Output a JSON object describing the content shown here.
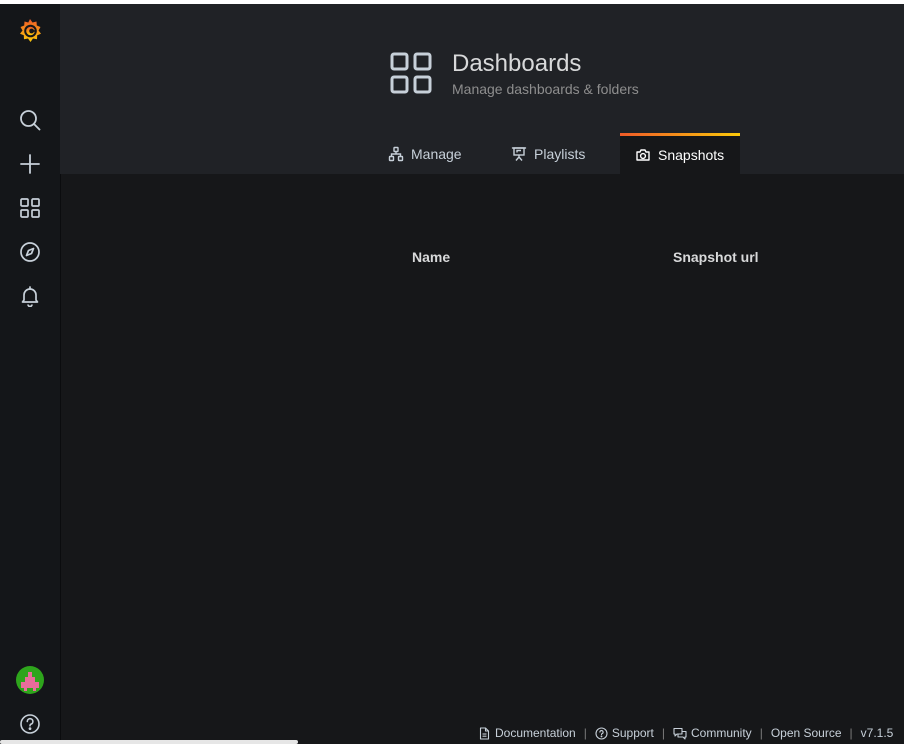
{
  "header": {
    "title": "Dashboards",
    "subtitle": "Manage dashboards & folders",
    "icon": "apps-icon"
  },
  "tabs": [
    {
      "label": "Manage",
      "icon": "sitemap-icon",
      "active": false
    },
    {
      "label": "Playlists",
      "icon": "presentation-icon",
      "active": false
    },
    {
      "label": "Snapshots",
      "icon": "camera-icon",
      "active": true
    }
  ],
  "table": {
    "columns": [
      "Name",
      "Snapshot url"
    ]
  },
  "sidebar": {
    "items": [
      "grafana-logo",
      "search-icon",
      "plus-icon",
      "apps-icon",
      "compass-icon",
      "bell-icon",
      "avatar",
      "help-icon"
    ]
  },
  "footer": {
    "links": [
      {
        "label": "Documentation",
        "icon": "document-icon"
      },
      {
        "label": "Support",
        "icon": "question-circle-icon"
      },
      {
        "label": "Community",
        "icon": "comments-icon"
      },
      {
        "label": "Open Source",
        "icon": ""
      },
      {
        "label": "v7.1.5",
        "icon": ""
      }
    ]
  },
  "colors": {
    "background": "#161719",
    "header_bg": "#202226",
    "sidebar_bg": "#141619",
    "accent_gradient_start": "#f05a28",
    "accent_gradient_end": "#fbca0a",
    "text": "#d8d9da",
    "avatar_bg": "#2ea51c"
  }
}
